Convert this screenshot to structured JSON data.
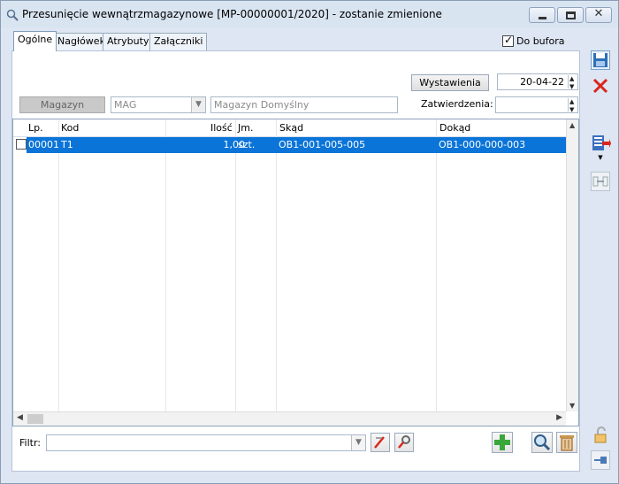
{
  "window": {
    "title": "Przesunięcie wewnątrzmagazynowe [MP-00000001/2020]  - zostanie zmienione"
  },
  "tabs": [
    {
      "label": "Ogólne",
      "active": true
    },
    {
      "label": "Nagłówek",
      "active": false
    },
    {
      "label": "Atrybuty",
      "active": false
    },
    {
      "label": "Załączniki",
      "active": false
    }
  ],
  "buffer": {
    "label": "Do bufora",
    "checked": true
  },
  "dates": {
    "issue_button": "Wystawienia",
    "issue_value": "20-04-22",
    "approval_label": "Zatwierdzenia:",
    "approval_value": ""
  },
  "warehouse": {
    "button": "Magazyn",
    "code": "MAG",
    "name": "Magazyn Domyślny"
  },
  "grid": {
    "columns": [
      "Lp.",
      "Kod",
      "Ilość",
      "Jm.",
      "Skąd",
      "Dokąd"
    ],
    "rows": [
      {
        "lp": "00001",
        "kod": "T1",
        "ilosc": "1,00",
        "jm": "szt.",
        "skad": "OB1-001-005-005",
        "dokad": "OB1-000-000-003"
      }
    ]
  },
  "filter": {
    "label": "Filtr:",
    "value": ""
  },
  "icons": {
    "save": "save-icon",
    "cancel": "cancel-icon",
    "export": "export-icon",
    "transfer": "transfer-icon",
    "lock": "lock-icon",
    "pin": "pin-icon",
    "add": "add-icon",
    "search": "search-icon",
    "delete": "trash-icon"
  },
  "colors": {
    "selection": "#0a74d8",
    "accent_red": "#d9261c",
    "accent_green": "#3aa73a"
  }
}
